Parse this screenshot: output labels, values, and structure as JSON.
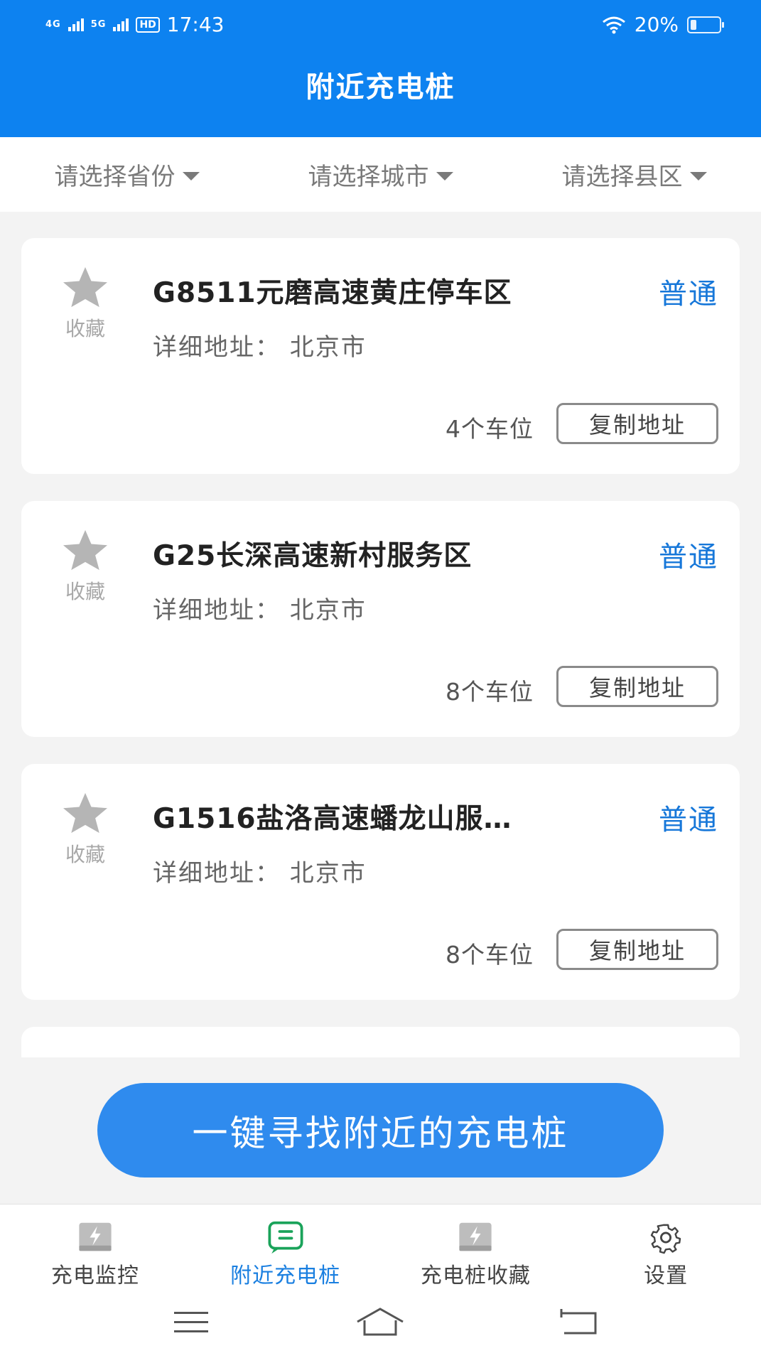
{
  "status_bar": {
    "signal1": "4G",
    "signal2": "5G",
    "hd": "HD",
    "time": "17:43",
    "battery": "20%"
  },
  "header": {
    "title": "附近充电桩"
  },
  "filters": [
    {
      "label": "请选择省份"
    },
    {
      "label": "请选择城市"
    },
    {
      "label": "请选择县区"
    }
  ],
  "stations": [
    {
      "fav_label": "收藏",
      "name": "G8511元磨高速黄庄停车区",
      "type": "普通",
      "address": "详细地址：  北京市",
      "spaces": "4个车位",
      "copy_label": "复制地址"
    },
    {
      "fav_label": "收藏",
      "name": "G25长深高速新村服务区",
      "type": "普通",
      "address": "详细地址：  北京市",
      "spaces": "8个车位",
      "copy_label": "复制地址"
    },
    {
      "fav_label": "收藏",
      "name": "G1516盐洛高速蟠龙山服…",
      "type": "普通",
      "address": "详细地址：  北京市",
      "spaces": "8个车位",
      "copy_label": "复制地址"
    }
  ],
  "find_button": {
    "label": "一键寻找附近的充电桩"
  },
  "tabs": [
    {
      "label": "充电监控",
      "icon": "charge-monitor-icon"
    },
    {
      "label": "附近充电桩",
      "icon": "nearby-charger-icon",
      "active": true
    },
    {
      "label": "充电桩收藏",
      "icon": "charger-favorites-icon"
    },
    {
      "label": "设置",
      "icon": "gear-icon"
    }
  ],
  "colors": {
    "primary": "#0d82f0",
    "accent_blue": "#1677d9",
    "active_green": "#1aa35a",
    "button": "#2f8bee"
  }
}
